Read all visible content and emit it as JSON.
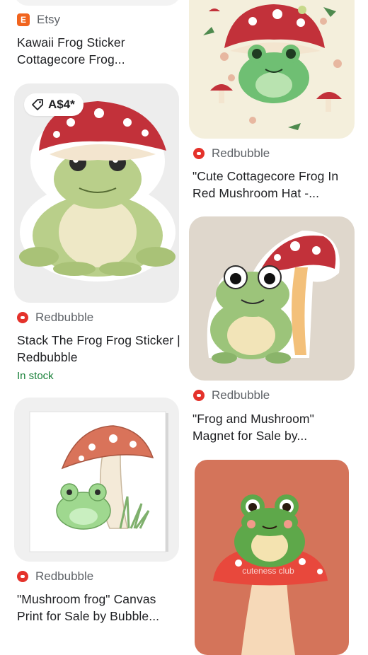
{
  "cards": [
    {
      "source": "Etsy",
      "source_logo": "E",
      "title": "Kawaii Frog Sticker Cottagecore Frog..."
    },
    {
      "source": "Redbubble",
      "price": "A$4*",
      "title": "Stack The Frog Frog Sticker | Redbubble",
      "stock": "In stock"
    },
    {
      "source": "Redbubble",
      "title": "\"Mushroom frog\" Canvas Print for Sale by Bubble..."
    },
    {
      "source": "Redbubble",
      "title": "\"Cute Cottagecore Frog In Red Mushroom Hat -..."
    },
    {
      "source": "Redbubble",
      "title": "\"Frog and Mushroom\" Magnet for Sale by..."
    },
    {
      "watermark": "cuteness club"
    }
  ],
  "icons": {
    "price_tag": "tag-icon",
    "redbubble": "redbubble-logo-icon",
    "etsy": "etsy-logo-icon"
  },
  "colors": {
    "redbubble": "#e4322b",
    "etsy": "#f1641e",
    "in_stock": "#188038"
  }
}
